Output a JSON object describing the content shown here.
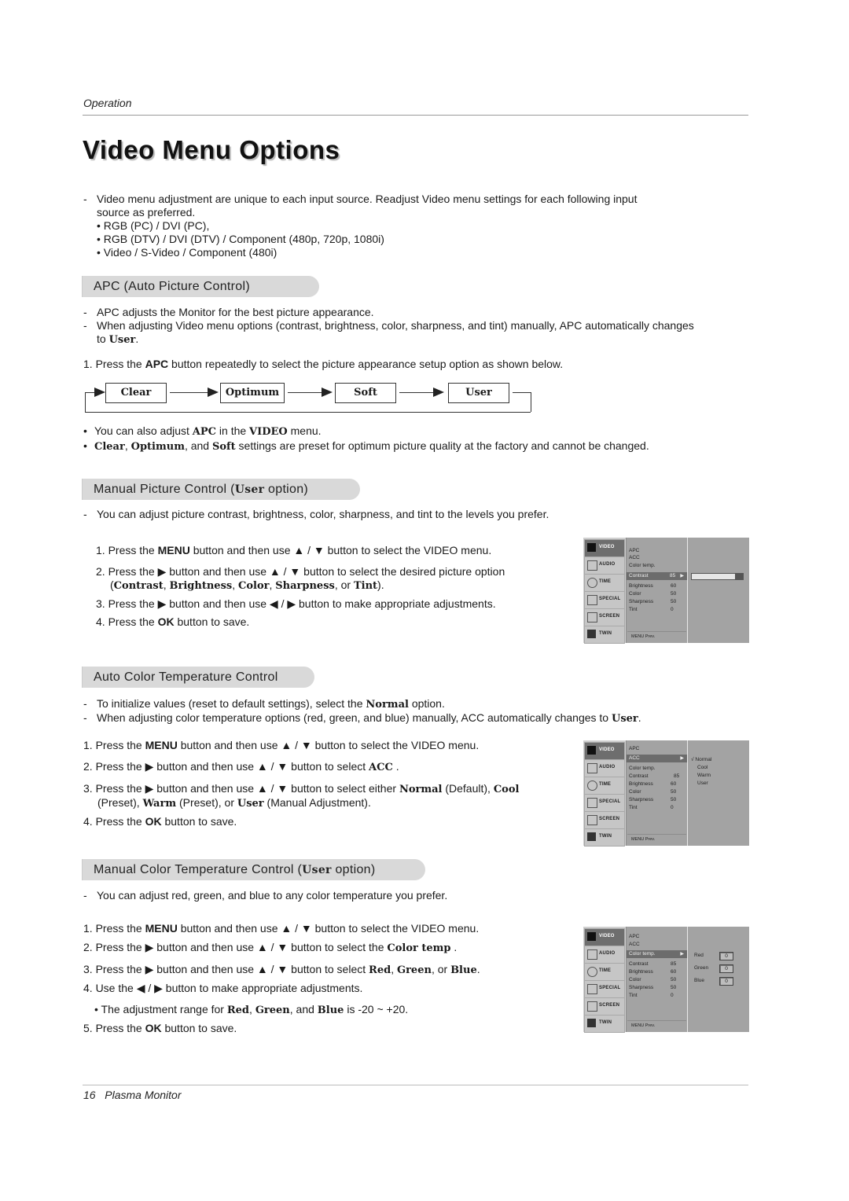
{
  "header": {
    "section": "Operation",
    "title": "Video Menu Options"
  },
  "intro": {
    "text": "Video menu adjustment are unique to each input source. Readjust Video menu settings for each following input source as preferred.",
    "sources": [
      "RGB (PC) / DVI (PC),",
      "RGB (DTV) / DVI (DTV) / Component (480p, 720p, 1080i)",
      "Video / S-Video / Component (480i)"
    ]
  },
  "apc": {
    "heading": "APC (Auto Picture Control)",
    "notes": [
      "APC adjusts the Monitor for the best picture appearance.",
      "When adjusting Video menu options (contrast, brightness, color, sharpness, and tint) manually, APC automatically changes to "
    ],
    "user": "User",
    "step1_a": "1. Press the ",
    "step1_b": "APC",
    "step1_c": " button repeatedly to select the picture appearance setup option as shown below.",
    "cycle": [
      "Clear",
      "Optimum",
      "Soft",
      "User"
    ],
    "bullet1_a": "You can also adjust ",
    "bullet1_b": "APC",
    "bullet1_c": " in the ",
    "bullet1_d": "VIDEO",
    "bullet1_e": " menu.",
    "bullet2_a": "Clear",
    "bullet2_b": ", ",
    "bullet2_c": "Optimum",
    "bullet2_d": ", and ",
    "bullet2_e": "Soft",
    "bullet2_f": " settings are preset for optimum picture quality at the factory and cannot be changed."
  },
  "manual_picture": {
    "heading_a": "Manual Picture Control (",
    "heading_b": "User",
    "heading_c": " option)",
    "note": "You can adjust picture contrast, brightness, color, sharpness, and tint to the levels you prefer.",
    "s1_a": "1.  Press the ",
    "s1_b": "MENU",
    "s1_c": " button and then use ▲ / ▼  button to select the VIDEO menu.",
    "s2_a": "2.  Press the ▶  button and then use ▲ / ▼ button to select the desired picture option",
    "s2_b": "(",
    "s2_c": "Contrast",
    "s2_d": ", ",
    "s2_e": "Brightness",
    "s2_f": ", ",
    "s2_g": "Color",
    "s2_h": ", ",
    "s2_i": "Sharpness",
    "s2_j": ", or ",
    "s2_k": "Tint",
    "s2_l": ").",
    "s3": "3.  Press the ▶ button and then use ◀ / ▶ button to make appropriate adjustments.",
    "s4_a": "4.  Press the ",
    "s4_b": "OK",
    "s4_c": " button to save."
  },
  "auto_color": {
    "heading": "Auto Color Temperature Control",
    "n1_a": "To initialize values (reset to default settings), select the ",
    "n1_b": "Normal",
    "n1_c": " option.",
    "n2_a": "When adjusting color temperature options (red, green, and blue) manually, ACC automatically changes to ",
    "n2_b": "User",
    "n2_c": ".",
    "s1_a": "1. Press the ",
    "s1_b": "MENU",
    "s1_c": " button and then use ▲ / ▼  button to select the VIDEO menu.",
    "s2_a": "2. Press the ▶  button and then use ▲ / ▼ button to select ",
    "s2_b": "ACC",
    "s2_c": " .",
    "s3_a": "3. Press the ▶  button and then use ▲ / ▼ button to select either ",
    "s3_b": "Normal",
    "s3_c": " (Default), ",
    "s3_d": "Cool",
    "s3_e": "(Preset), ",
    "s3_f": "Warm",
    "s3_g": " (Preset), or ",
    "s3_h": "User",
    "s3_i": " (Manual Adjustment).",
    "s4_a": "4. Press the ",
    "s4_b": "OK",
    "s4_c": " button to save."
  },
  "manual_color": {
    "heading_a": "Manual Color Temperature Control (",
    "heading_b": "User",
    "heading_c": " option)",
    "note": "You can adjust red, green, and blue to any color temperature you prefer.",
    "s1_a": "1.  Press the ",
    "s1_b": "MENU",
    "s1_c": " button and then use ▲ / ▼  button to select the VIDEO menu.",
    "s2_a": "2.  Press the ▶ button and then use ▲ / ▼ button to select the ",
    "s2_b": "Color temp",
    "s2_c": " .",
    "s3_a": "3. Press the ▶  button and then use ▲ / ▼ button to select ",
    "s3_b": "Red",
    "s3_c": ", ",
    "s3_d": "Green",
    "s3_e": ", or ",
    "s3_f": "Blue",
    "s3_g": ".",
    "s4": "4.  Use the ◀ / ▶ button to make appropriate adjustments.",
    "range_a": "• The adjustment range for ",
    "range_b": "Red",
    "range_c": ", ",
    "range_d": "Green",
    "range_e": ", and ",
    "range_f": "Blue",
    "range_g": " is -20 ~ +20.",
    "s5_a": "5.  Press the ",
    "s5_b": "OK",
    "s5_c": " button to save."
  },
  "osd": {
    "side_items": [
      "VIDEO",
      "AUDIO",
      "TIME",
      "SPECIAL",
      "SCREEN",
      "TWIN"
    ],
    "labels": {
      "apc": "APC",
      "acc": "ACC",
      "color_temp": "Color temp.",
      "contrast": "Contrast",
      "brightness": "Brightness",
      "color": "Color",
      "sharpness": "Sharpness",
      "tint": "Tint"
    },
    "values": {
      "contrast": "85",
      "brightness": "60",
      "color": "50",
      "sharpness": "50",
      "tint": "0"
    },
    "contrast_level": 0.85,
    "footer": "MENU  Prev.",
    "acc_options": [
      "√ Normal",
      "Cool",
      "Warm",
      "User"
    ],
    "rgb": [
      {
        "label": "Red",
        "value": "0"
      },
      {
        "label": "Green",
        "value": "0"
      },
      {
        "label": "Blue",
        "value": "0"
      }
    ],
    "arrow": "▶"
  },
  "footer": {
    "page": "16",
    "title": "Plasma Monitor"
  }
}
